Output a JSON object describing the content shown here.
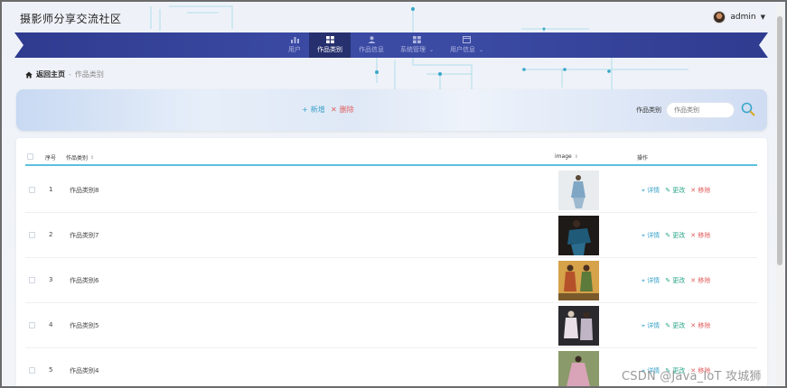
{
  "app": {
    "title": "摄影师分享交流社区",
    "user_name": "admin"
  },
  "nav": {
    "items": [
      {
        "label": "用户",
        "icon": "bar-chart-icon",
        "active": false
      },
      {
        "label": "作品类别",
        "icon": "grid-icon",
        "active": true
      },
      {
        "label": "作品信息",
        "icon": "person-icon",
        "active": false
      },
      {
        "label": "系统管理",
        "icon": "grid-icon",
        "active": false,
        "has_dropdown": true
      },
      {
        "label": "用户信息",
        "icon": "window-icon",
        "active": false,
        "has_dropdown": true
      }
    ]
  },
  "breadcrumb": {
    "home": "返回主页",
    "separator": "-",
    "current": "作品类别"
  },
  "toolbar": {
    "add_label": "新增",
    "delete_label": "删除",
    "filter_label": "作品类别",
    "filter_placeholder": "作品类别"
  },
  "table": {
    "headers": {
      "index": "序号",
      "name": "作品类别",
      "image": "image",
      "actions": "操作"
    },
    "action_labels": {
      "detail": "详情",
      "edit": "更改",
      "remove": "移除"
    },
    "rows": [
      {
        "index": "1",
        "name": "作品类别8"
      },
      {
        "index": "2",
        "name": "作品类别7"
      },
      {
        "index": "3",
        "name": "作品类别6"
      },
      {
        "index": "4",
        "name": "作品类别5"
      },
      {
        "index": "5",
        "name": "作品类别4"
      }
    ]
  },
  "watermark": "CSDN @Java_IoT 攻城狮",
  "colors": {
    "nav_band": "#3b4aa3",
    "nav_active": "#26306e",
    "accent": "#39a3c9",
    "danger": "#e05c5c",
    "edit": "#2aa58a",
    "header_rule": "#5bc0de"
  }
}
